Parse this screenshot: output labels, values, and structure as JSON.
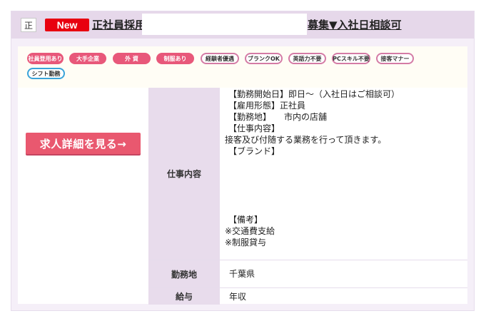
{
  "header": {
    "type_icon": "正",
    "new_badge": "New",
    "title_prefix": "正社員採用",
    "title_suffix": "募集▼入社日相談可"
  },
  "tags": [
    {
      "label": "社員登用あり",
      "style": "fill"
    },
    {
      "label": "大手企業",
      "style": "fill"
    },
    {
      "label": "外 資",
      "style": "fill"
    },
    {
      "label": "制服あり",
      "style": "fill"
    },
    {
      "label": "経験者優遇",
      "style": "outline"
    },
    {
      "label": "ブランクOK",
      "style": "outline"
    },
    {
      "label": "英語力不要",
      "style": "outline"
    },
    {
      "label": "PCスキル不要",
      "style": "outline"
    },
    {
      "label": "接客マナー",
      "style": "outline"
    },
    {
      "label": "シフト勤務",
      "style": "blue"
    }
  ],
  "detail_button": {
    "label": "求人詳細を見る→"
  },
  "job_rows": {
    "content_label": "仕事内容",
    "content_lines": [
      "【勤務開始日】即日～（入社日はご相談可）",
      "【雇用形態】正社員",
      "【勤務地】　　市内の店舗",
      "【仕事内容】",
      "接客及び付随する業務を行って頂きます。",
      "【ブランド】",
      "【備考】",
      "※交通費支給",
      "※制服貸与"
    ],
    "location_label": "勤務地",
    "location_value": "千葉県",
    "salary_label": "給与",
    "salary_value": "年収"
  },
  "colors": {
    "accent_pink": "#e8587a",
    "new_red": "#e8000f",
    "header_bg": "#e6d8ea",
    "label_bg": "#e8dcec"
  }
}
